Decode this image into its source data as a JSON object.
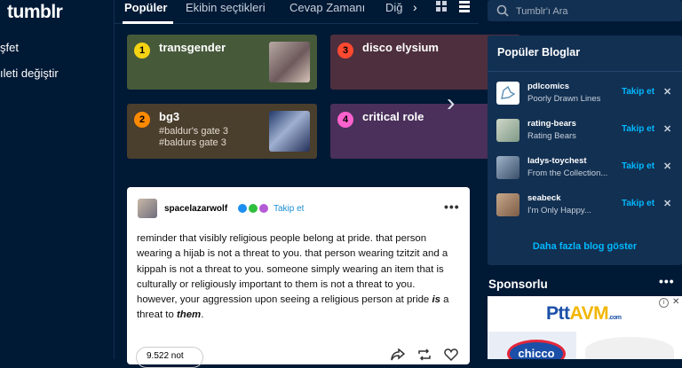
{
  "app": {
    "logo": "tumblr"
  },
  "sidebar": {
    "items": [
      {
        "label": "şfet"
      },
      {
        "label": "ıleti değiştir"
      }
    ]
  },
  "tabs": {
    "items": [
      {
        "label": "Popüler"
      },
      {
        "label": "Ekibin seçtikleri"
      },
      {
        "label": "Cevap Zamanı"
      },
      {
        "label": "Diğ"
      }
    ],
    "active_index": 0,
    "next_icon": "chevron-right-icon"
  },
  "tags": [
    {
      "rank": "1",
      "title": "transgender",
      "sub": [],
      "color": "#465a3a",
      "badge": "#f5d312"
    },
    {
      "rank": "3",
      "title": "disco elysium",
      "sub": [],
      "color": "#4e2f3d",
      "badge": "#ff4930"
    },
    {
      "rank": "2",
      "title": "bg3",
      "sub": [
        "#baldur's gate 3",
        "#baldurs gate 3"
      ],
      "color": "#4a3e2d",
      "badge": "#ff8a00"
    },
    {
      "rank": "4",
      "title": "critical role",
      "sub": [],
      "color": "#4a305a",
      "badge": "#ff62ce"
    }
  ],
  "post": {
    "username": "spacelazarwolf",
    "follow_label": "Takip et",
    "menu_icon": "ellipsis-icon",
    "body": {
      "t1": "reminder that visibly religious people belong at pride. that person wearing a hijab is not a threat to you. that person wearing tzitzit and a kippah is not a threat to you. someone simply wearing an item that is culturally or religiously important to them is not a threat to you. however, your aggression upon seeing a religious person at pride ",
      "em1": "is",
      "t2": " a threat to ",
      "em2": "them",
      "t3": "."
    },
    "notes_label": "9.522 not"
  },
  "search": {
    "placeholder": "Tumblr'ı Ara"
  },
  "popular_blogs": {
    "title": "Popüler Bloglar",
    "items": [
      {
        "name": "pdlcomics",
        "desc": "Poorly Drawn Lines",
        "follow": "Takip et"
      },
      {
        "name": "rating-bears",
        "desc": "Rating Bears",
        "follow": "Takip et"
      },
      {
        "name": "ladys-toychest",
        "desc": "From the Collection...",
        "follow": "Takip et"
      },
      {
        "name": "seabeck",
        "desc": "I'm Only Happy...",
        "follow": "Takip et"
      }
    ],
    "more_label": "Daha fazla blog göster"
  },
  "sponsored": {
    "title": "Sponsorlu",
    "ad_brand_a": "Ptt",
    "ad_brand_b": "AVM",
    "ad_domain": ".com",
    "ad_product": "chicco"
  }
}
